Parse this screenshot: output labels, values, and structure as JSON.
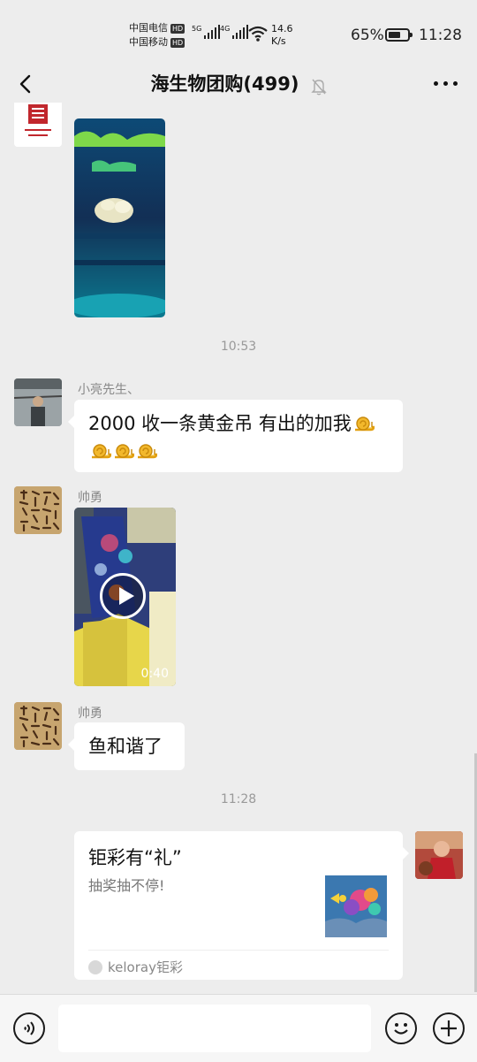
{
  "status_bar": {
    "carrier_1": "中国电信",
    "carrier_2": "中国移动",
    "hd_badge": "HD",
    "net_5g": "5G",
    "net_4g": "4G",
    "speed_value": "14.6",
    "speed_unit": "K/s",
    "battery_percent": "65%",
    "battery_level": 0.65,
    "time": "11:28"
  },
  "header": {
    "title": "海生物团购(499)"
  },
  "messages": {
    "time_1": "10:53",
    "msg_1": {
      "sender": "小亮先生、",
      "text": "2000 收一条黄金吊 有出的加我",
      "emoji": "🐌",
      "emoji_count": 4
    },
    "msg_2": {
      "sender": "帅勇",
      "video_duration": "0:40"
    },
    "msg_3": {
      "sender": "帅勇",
      "text": "鱼和谐了"
    },
    "time_2": "11:28",
    "card": {
      "title": "钜彩有“礼”",
      "subtitle": "抽奖抽不停!",
      "source": "keloray钜彩"
    }
  },
  "colors": {
    "background": "#ededed",
    "bubble": "#ffffff",
    "secondary_text": "#888888"
  }
}
